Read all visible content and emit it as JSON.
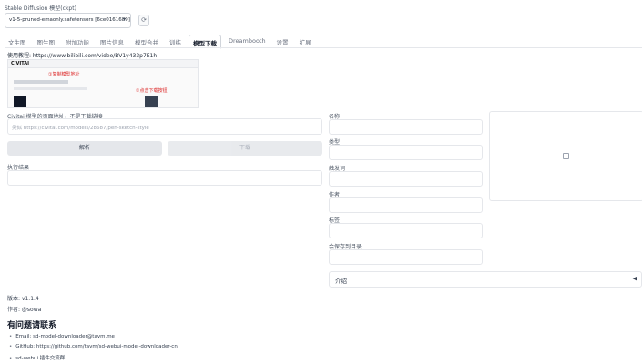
{
  "header": {
    "checkpoint_label": "Stable Diffusion 模型(ckpt)",
    "checkpoint_value": "v1-5-pruned-emaonly.safetensors [6ce0161689]",
    "refresh_icon": "refresh-icon"
  },
  "tabs": [
    {
      "label": "文生图"
    },
    {
      "label": "图生图"
    },
    {
      "label": "附加功能"
    },
    {
      "label": "图片信息"
    },
    {
      "label": "模型合并"
    },
    {
      "label": "训练"
    },
    {
      "label": "模型下载"
    },
    {
      "label": "Dreambooth"
    },
    {
      "label": "设置"
    },
    {
      "label": "扩展"
    }
  ],
  "active_tab": "模型下载",
  "main": {
    "tutorial": "使用教程: https://www.bilibili.com/video/BV1y433p7E1h",
    "tutorial_image": {
      "brand": "CIVITAI",
      "note_top": "①复制模型地址",
      "note_right": "②点击下载按钮"
    },
    "url_label": "Civitai 模型的页面地址，不是下载链接",
    "url_placeholder": "类似 https://civitai.com/models/28687/pen-sketch-style",
    "parse_label": "解析",
    "download_label": "下载",
    "result_label": "执行结果"
  },
  "fields": {
    "name": "名称",
    "type": "类型",
    "trigger": "触发词",
    "author": "作者",
    "tags": "标签",
    "save_path": "会保存到目录",
    "intro": "介绍",
    "intro_arrow": "◀"
  },
  "footer": {
    "version": "版本: v1.1.4",
    "author": "作者: @sowa",
    "contact_title": "有问题请联系",
    "contacts": [
      "Email: sd-model-downloader@tavm.me",
      "GitHub: https://github.com/tavm/sd-webui-model-downloader-cn",
      "sd-webui 插件交流群"
    ]
  }
}
